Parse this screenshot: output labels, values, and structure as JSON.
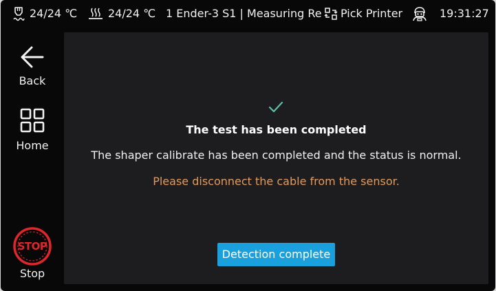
{
  "status_bar": {
    "nozzle_temp": "24/24 ℃",
    "bed_temp": "24/24 ℃",
    "printer_status": "1 Ender-3 S1 | Measuring Re",
    "pick_printer_label": "Pick Printer",
    "time": "19:31:27",
    "icons": {
      "nozzle": "nozzle-temperature-icon",
      "bed": "heated-bed-icon",
      "pick_printer": "pick-printer-icon",
      "user": "robot-user-icon"
    }
  },
  "nav": {
    "back_label": "Back",
    "home_label": "Home",
    "stop_label": "Stop",
    "stop_badge": "STOP"
  },
  "result": {
    "title": "The test has been completed",
    "message": "The shaper calibrate has been completed and the status is normal.",
    "warning": "Please disconnect the cable from the sensor.",
    "button_label": "Detection complete"
  },
  "colors": {
    "background": "#080808",
    "panel": "#1d1d1f",
    "accent_button": "#1aa0dc",
    "warning_text": "#e39a5c",
    "check": "#5fbfaa",
    "stop_red": "#e0262b"
  }
}
